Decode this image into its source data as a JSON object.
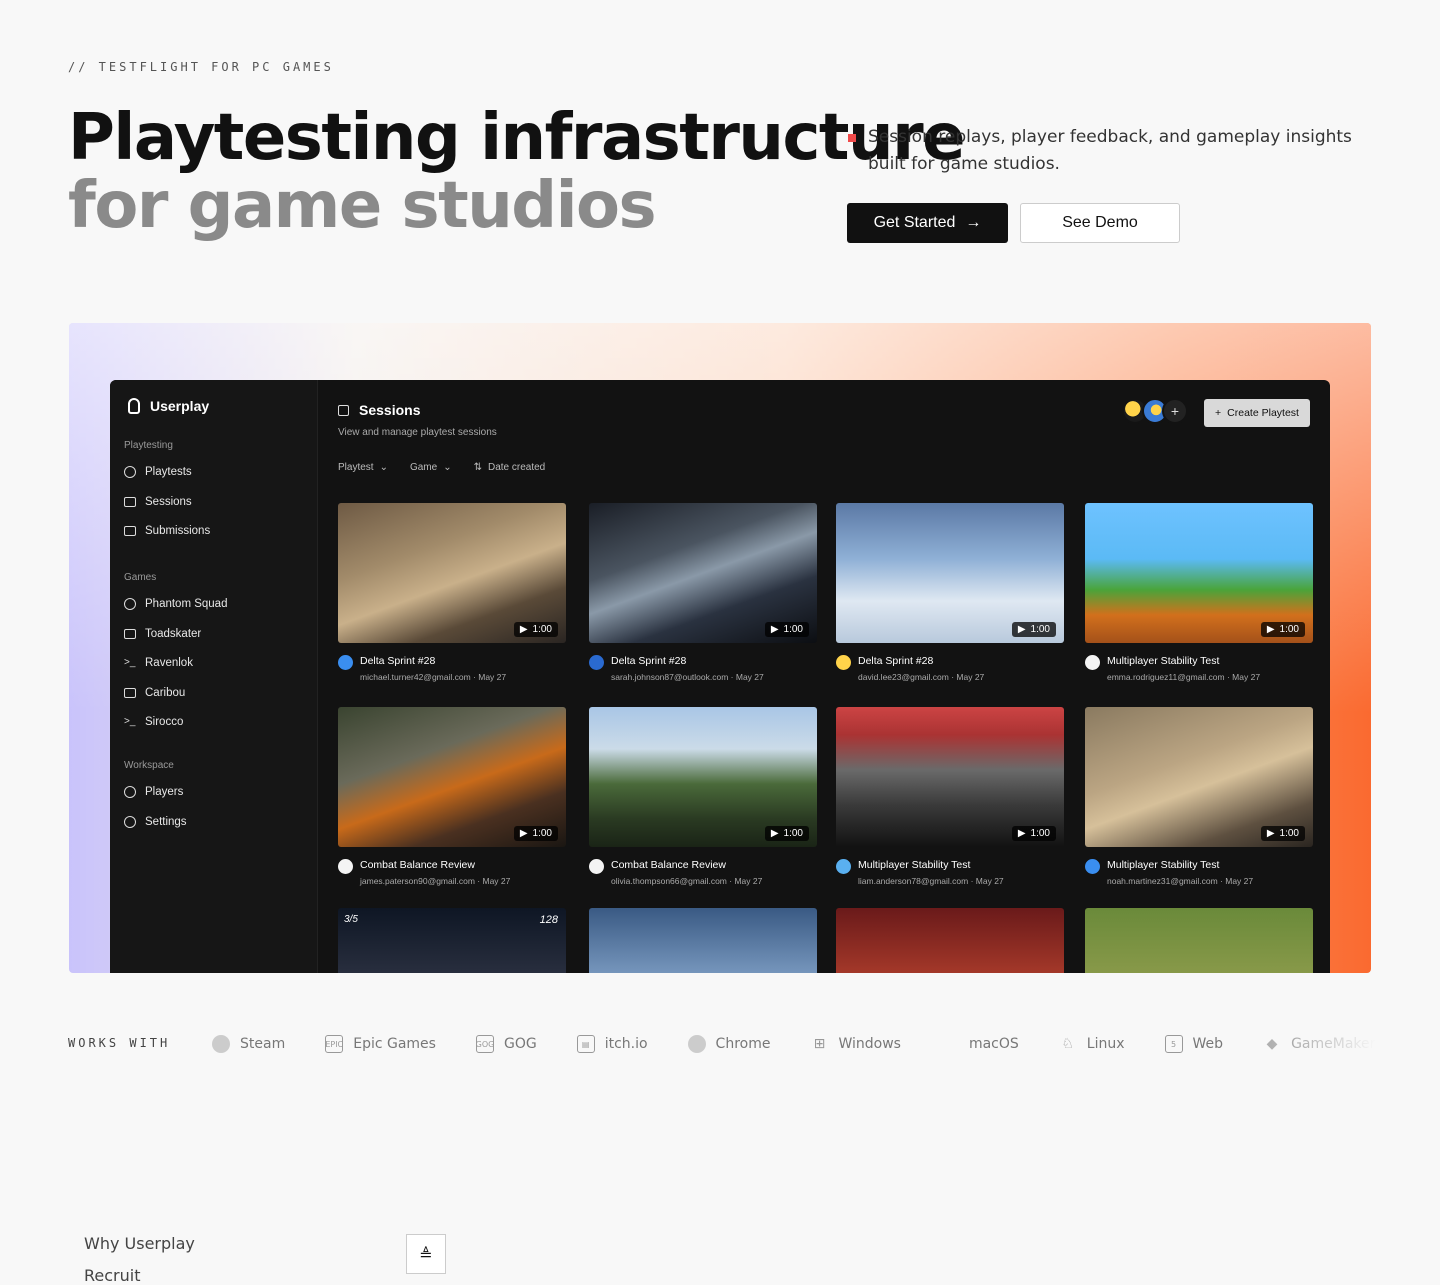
{
  "eyebrow": "// TESTFLIGHT FOR PC GAMES",
  "headline": {
    "line1": "Playtesting infrastructure",
    "line2": "for game studios"
  },
  "tagline": "Session replays, player feedback, and gameplay insights built for game studios.",
  "buttons": {
    "primary": "Get Started",
    "secondary": "See Demo"
  },
  "colors": {
    "accent_red": "#f04a4a",
    "app_bg": "#121212",
    "gradient_left": "#c9c3fb",
    "gradient_right": "#fa6a30"
  },
  "app": {
    "brand": "Userplay",
    "sidebar": {
      "sections": [
        {
          "label": "Playtesting",
          "items": [
            "Playtests",
            "Sessions",
            "Submissions"
          ]
        },
        {
          "label": "Games",
          "items": [
            "Phantom Squad",
            "Toadskater",
            "Ravenlok",
            "Caribou",
            "Sirocco"
          ]
        },
        {
          "label": "Workspace",
          "items": [
            "Players",
            "Settings"
          ]
        }
      ]
    },
    "page": {
      "title": "Sessions",
      "subtitle": "View and manage playtest sessions"
    },
    "filters": [
      "Playtest",
      "Game",
      "Date created"
    ],
    "create_button": "Create Playtest",
    "avatar_add": "+",
    "sessions": [
      {
        "title": "Delta Sprint #28",
        "email": "michael.turner42@gmail.com",
        "date": "May 27",
        "duration": "1:00",
        "theme": "cs",
        "avatar": "#3a8ef0"
      },
      {
        "title": "Delta Sprint #28",
        "email": "sarah.johnson87@outlook.com",
        "date": "May 27",
        "duration": "1:00",
        "theme": "lab",
        "avatar": "#2a6ad0"
      },
      {
        "title": "Delta Sprint #28",
        "email": "david.lee23@gmail.com",
        "date": "May 27",
        "duration": "1:00",
        "theme": "snow",
        "avatar": "#ffd34a"
      },
      {
        "title": "Multiplayer Stability Test",
        "email": "emma.rodriguez11@gmail.com",
        "date": "May 27",
        "duration": "1:00",
        "theme": "mario",
        "avatar": "#f4f4f4"
      },
      {
        "title": "Combat Balance Review",
        "email": "james.paterson90@gmail.com",
        "date": "May 27",
        "duration": "1:00",
        "theme": "fire",
        "avatar": "#f4f4f4"
      },
      {
        "title": "Combat Balance Review",
        "email": "olivia.thompson66@gmail.com",
        "date": "May 27",
        "duration": "1:00",
        "theme": "forest",
        "avatar": "#f4f4f4"
      },
      {
        "title": "Multiplayer Stability Test",
        "email": "liam.anderson78@gmail.com",
        "date": "May 27",
        "duration": "1:00",
        "theme": "race",
        "avatar": "#5ab0f0"
      },
      {
        "title": "Multiplayer Stability Test",
        "email": "noah.martinez31@gmail.com",
        "date": "May 27",
        "duration": "1:00",
        "theme": "cs2",
        "avatar": "#3a8ef0"
      },
      {
        "title": "",
        "email": "",
        "date": "",
        "duration": "",
        "theme": "night",
        "avatar": "",
        "overlay_left": "3/5",
        "overlay_right": "128"
      },
      {
        "title": "",
        "email": "",
        "date": "",
        "duration": "",
        "theme": "mount",
        "avatar": ""
      },
      {
        "title": "",
        "email": "",
        "date": "",
        "duration": "",
        "theme": "arena",
        "avatar": ""
      },
      {
        "title": "",
        "email": "",
        "date": "",
        "duration": "",
        "theme": "rts",
        "avatar": ""
      }
    ]
  },
  "works_with": {
    "label": "WORKS WITH",
    "platforms": [
      {
        "name": "Steam",
        "icon": "steam-icon"
      },
      {
        "name": "Epic Games",
        "icon": "epic-games-icon"
      },
      {
        "name": "GOG",
        "icon": "gog-icon"
      },
      {
        "name": "itch.io",
        "icon": "itchio-icon"
      },
      {
        "name": "Chrome",
        "icon": "chrome-icon"
      },
      {
        "name": "Windows",
        "icon": "windows-icon"
      },
      {
        "name": "macOS",
        "icon": "apple-icon"
      },
      {
        "name": "Linux",
        "icon": "linux-icon"
      },
      {
        "name": "Web",
        "icon": "html5-icon"
      },
      {
        "name": "GameMaker",
        "icon": "gamemaker-icon"
      }
    ]
  },
  "footer_links": [
    "Why Userplay",
    "Recruit"
  ]
}
